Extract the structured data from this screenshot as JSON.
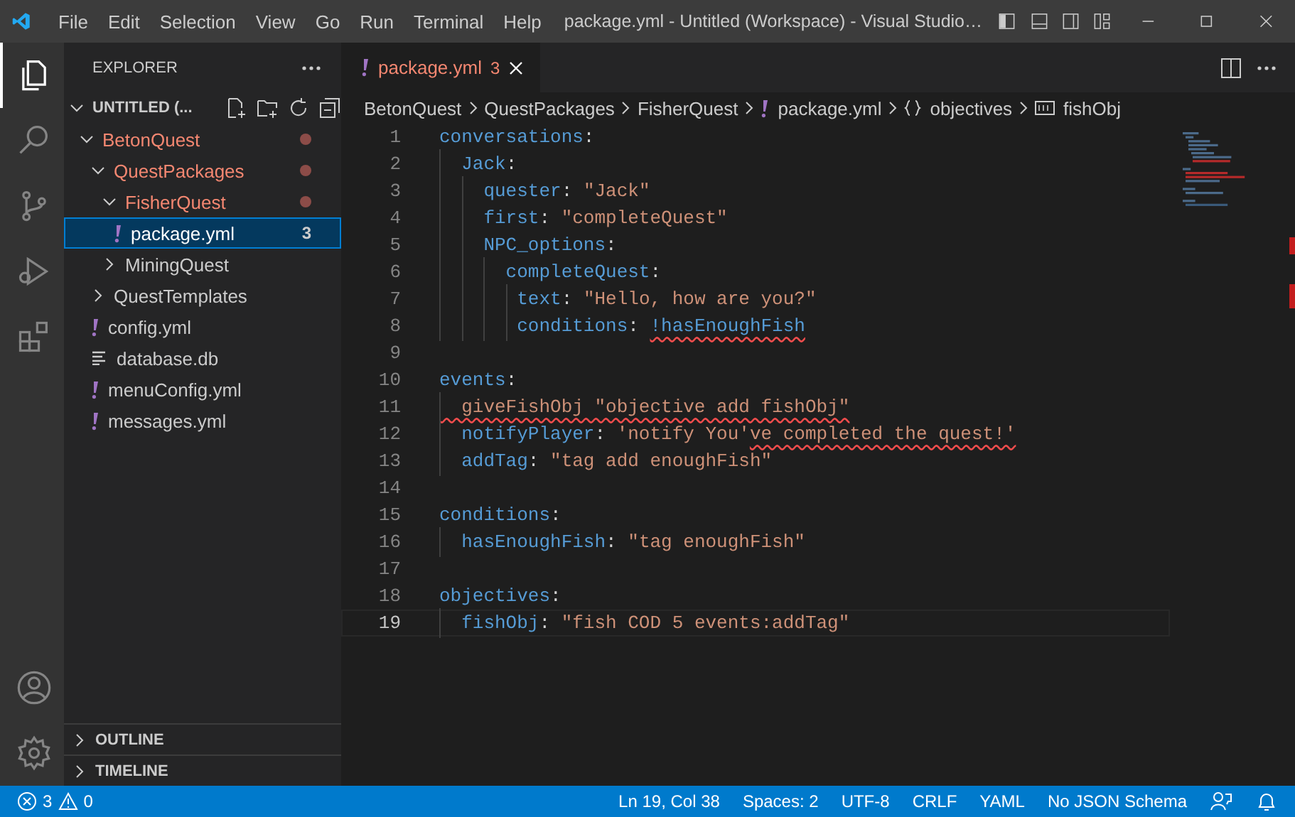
{
  "menu": [
    "File",
    "Edit",
    "Selection",
    "View",
    "Go",
    "Run",
    "Terminal",
    "Help"
  ],
  "window": {
    "title": "package.yml - Untitled (Workspace) - Visual Studio…"
  },
  "activity": [
    {
      "selected": true
    },
    {
      "selected": false
    },
    {
      "selected": false
    },
    {
      "selected": false
    },
    {
      "selected": false
    }
  ],
  "sidebar": {
    "title": "EXPLORER",
    "workspace": "UNTITLED (...",
    "tree": [
      {
        "label": "BetonQuest",
        "kind": "folder",
        "expanded": true,
        "modified": true,
        "selected": false,
        "children": [
          {
            "label": "QuestPackages",
            "kind": "folder",
            "expanded": true,
            "modified": true,
            "selected": false,
            "children": [
              {
                "label": "FisherQuest",
                "kind": "folder",
                "expanded": true,
                "modified": true,
                "selected": false,
                "children": [
                  {
                    "label": "package.yml",
                    "kind": "yaml",
                    "modified": false,
                    "selected": true,
                    "badge": "3"
                  }
                ]
              },
              {
                "label": "MiningQuest",
                "kind": "folder",
                "expanded": false,
                "modified": false,
                "selected": false
              }
            ]
          },
          {
            "label": "QuestTemplates",
            "kind": "folder",
            "expanded": false,
            "modified": false,
            "selected": false
          },
          {
            "label": "config.yml",
            "kind": "yaml",
            "modified": false,
            "selected": false
          },
          {
            "label": "database.db",
            "kind": "text",
            "modified": false,
            "selected": false
          },
          {
            "label": "menuConfig.yml",
            "kind": "yaml",
            "modified": false,
            "selected": false
          },
          {
            "label": "messages.yml",
            "kind": "yaml",
            "modified": false,
            "selected": false
          }
        ]
      }
    ],
    "panels": [
      {
        "label": "OUTLINE",
        "expanded": false
      },
      {
        "label": "TIMELINE",
        "expanded": false
      }
    ]
  },
  "tabs": [
    {
      "label": "package.yml",
      "badge": "3",
      "selected": true
    }
  ],
  "breadcrumbs": [
    {
      "label": "BetonQuest",
      "kind": "folder"
    },
    {
      "label": "QuestPackages",
      "kind": "folder"
    },
    {
      "label": "FisherQuest",
      "kind": "folder"
    },
    {
      "label": "package.yml",
      "kind": "file"
    },
    {
      "label": "objectives",
      "kind": "object"
    },
    {
      "label": "fishObj",
      "kind": "string"
    }
  ],
  "code": [
    {
      "number": "1",
      "current": false,
      "tokens": [
        {
          "kind": "key",
          "text": "conversations",
          "error": false
        },
        {
          "kind": "punct",
          "text": ":",
          "error": false
        }
      ]
    },
    {
      "number": "2",
      "current": false,
      "tokens": [
        {
          "kind": "key",
          "text": "  Jack",
          "error": false
        },
        {
          "kind": "punct",
          "text": ":",
          "error": false
        }
      ]
    },
    {
      "number": "3",
      "current": false,
      "tokens": [
        {
          "kind": "key",
          "text": "    quester",
          "error": false
        },
        {
          "kind": "punct",
          "text": ": ",
          "error": false
        },
        {
          "kind": "string",
          "text": "\"Jack\"",
          "error": false
        }
      ]
    },
    {
      "number": "4",
      "current": false,
      "tokens": [
        {
          "kind": "key",
          "text": "    first",
          "error": false
        },
        {
          "kind": "punct",
          "text": ": ",
          "error": false
        },
        {
          "kind": "string",
          "text": "\"completeQuest\"",
          "error": false
        }
      ]
    },
    {
      "number": "5",
      "current": false,
      "tokens": [
        {
          "kind": "key",
          "text": "    NPC_options",
          "error": false
        },
        {
          "kind": "punct",
          "text": ":",
          "error": false
        }
      ]
    },
    {
      "number": "6",
      "current": false,
      "tokens": [
        {
          "kind": "key",
          "text": "      completeQuest",
          "error": false
        },
        {
          "kind": "punct",
          "text": ":",
          "error": false
        }
      ]
    },
    {
      "number": "7",
      "current": false,
      "tokens": [
        {
          "kind": "key",
          "text": "       text",
          "error": false
        },
        {
          "kind": "punct",
          "text": ": ",
          "error": false
        },
        {
          "kind": "string",
          "text": "\"Hello, how are you?\"",
          "error": false
        }
      ]
    },
    {
      "number": "8",
      "current": false,
      "tokens": [
        {
          "kind": "key",
          "text": "       conditions",
          "error": false
        },
        {
          "kind": "punct",
          "text": ": ",
          "error": false
        },
        {
          "kind": "key",
          "text": "!hasEnoughFish",
          "error": true
        }
      ]
    },
    {
      "number": "9",
      "current": false
    },
    {
      "number": "10",
      "current": false,
      "tokens": [
        {
          "kind": "key",
          "text": "events",
          "error": false
        },
        {
          "kind": "punct",
          "text": ":",
          "error": false
        }
      ]
    },
    {
      "number": "11",
      "current": false,
      "tokens": [
        {
          "kind": "string",
          "text": "  giveFishObj \"objective add fishObj\"",
          "error": true
        }
      ]
    },
    {
      "number": "12",
      "current": false,
      "tokens": [
        {
          "kind": "key",
          "text": "  notifyPlayer",
          "error": false
        },
        {
          "kind": "punct",
          "text": ": ",
          "error": false
        },
        {
          "kind": "string",
          "text": "'notify You'",
          "error": false
        },
        {
          "kind": "string",
          "text": "ve completed the quest!'",
          "error": true
        }
      ]
    },
    {
      "number": "13",
      "current": false,
      "tokens": [
        {
          "kind": "key",
          "text": "  addTag",
          "error": false
        },
        {
          "kind": "punct",
          "text": ": ",
          "error": false
        },
        {
          "kind": "string",
          "text": "\"tag add enoughFish\"",
          "error": false
        }
      ]
    },
    {
      "number": "14",
      "current": false
    },
    {
      "number": "15",
      "current": false,
      "tokens": [
        {
          "kind": "key",
          "text": "conditions",
          "error": false
        },
        {
          "kind": "punct",
          "text": ":",
          "error": false
        }
      ]
    },
    {
      "number": "16",
      "current": false,
      "tokens": [
        {
          "kind": "key",
          "text": "  hasEnoughFish",
          "error": false
        },
        {
          "kind": "punct",
          "text": ": ",
          "error": false
        },
        {
          "kind": "string",
          "text": "\"tag enoughFish\"",
          "error": false
        }
      ]
    },
    {
      "number": "17",
      "current": false
    },
    {
      "number": "18",
      "current": false,
      "tokens": [
        {
          "kind": "key",
          "text": "objectives",
          "error": false
        },
        {
          "kind": "punct",
          "text": ":",
          "error": false
        }
      ]
    },
    {
      "number": "19",
      "current": true,
      "tokens": [
        {
          "kind": "key",
          "text": "  fishObj",
          "error": false
        },
        {
          "kind": "punct",
          "text": ": ",
          "error": false
        },
        {
          "kind": "string",
          "text": "\"fish COD 5 events:addTag\"",
          "error": false
        }
      ]
    }
  ],
  "status_bar": {
    "errors": "3",
    "warnings": "0",
    "items": [
      "Ln 19, Col 38",
      "Spaces: 2",
      "UTF-8",
      "CRLF",
      "YAML",
      "No JSON Schema"
    ]
  }
}
